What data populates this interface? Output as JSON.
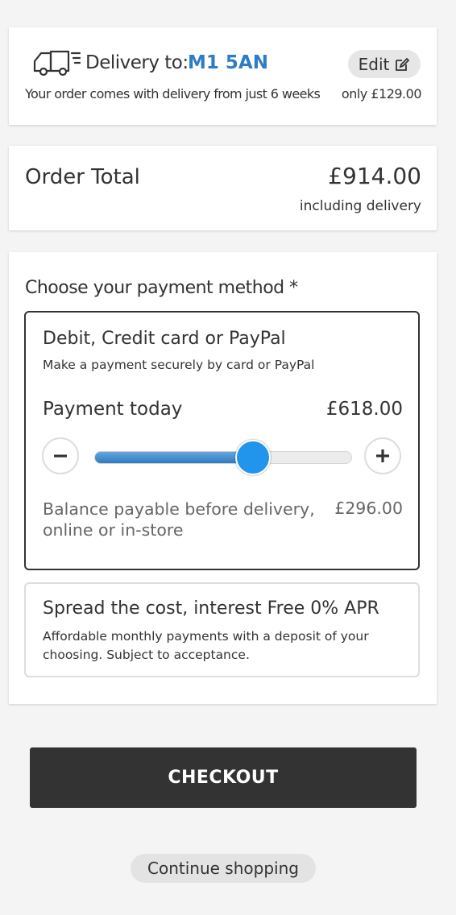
{
  "delivery": {
    "label": "Delivery to:",
    "postcode": "M1 5AN",
    "edit_label": "Edit",
    "note": "Your order comes with delivery from just 6 weeks",
    "price": "only £129.00",
    "icons": {
      "truck": "truck-icon",
      "edit": "edit-icon"
    }
  },
  "order_total": {
    "label": "Order Total",
    "value": "£914.00",
    "note": "including delivery"
  },
  "payment": {
    "heading": "Choose your payment method *",
    "options": [
      {
        "title": "Debit, Credit card or PayPal",
        "subtitle": "Make a payment securely by card or PayPal",
        "selected": true,
        "payment_today_label": "Payment today",
        "payment_today_value": "£618.00",
        "slider_fraction": 0.62,
        "balance_label": "Balance payable before delivery, online or in-store",
        "balance_value": "£296.00",
        "icons": {
          "decrease": "minus-icon",
          "increase": "plus-icon"
        }
      },
      {
        "title": "Spread the cost, interest Free 0% APR",
        "subtitle": "Affordable monthly payments with a deposit of your choosing. Subject to acceptance.",
        "selected": false
      }
    ]
  },
  "actions": {
    "checkout_label": "CHECKOUT",
    "continue_label": "Continue shopping"
  },
  "colors": {
    "accent": "#2e7cc4",
    "slider_thumb": "#2195ec",
    "button_dark": "#333333",
    "background": "#f4f4f4"
  }
}
